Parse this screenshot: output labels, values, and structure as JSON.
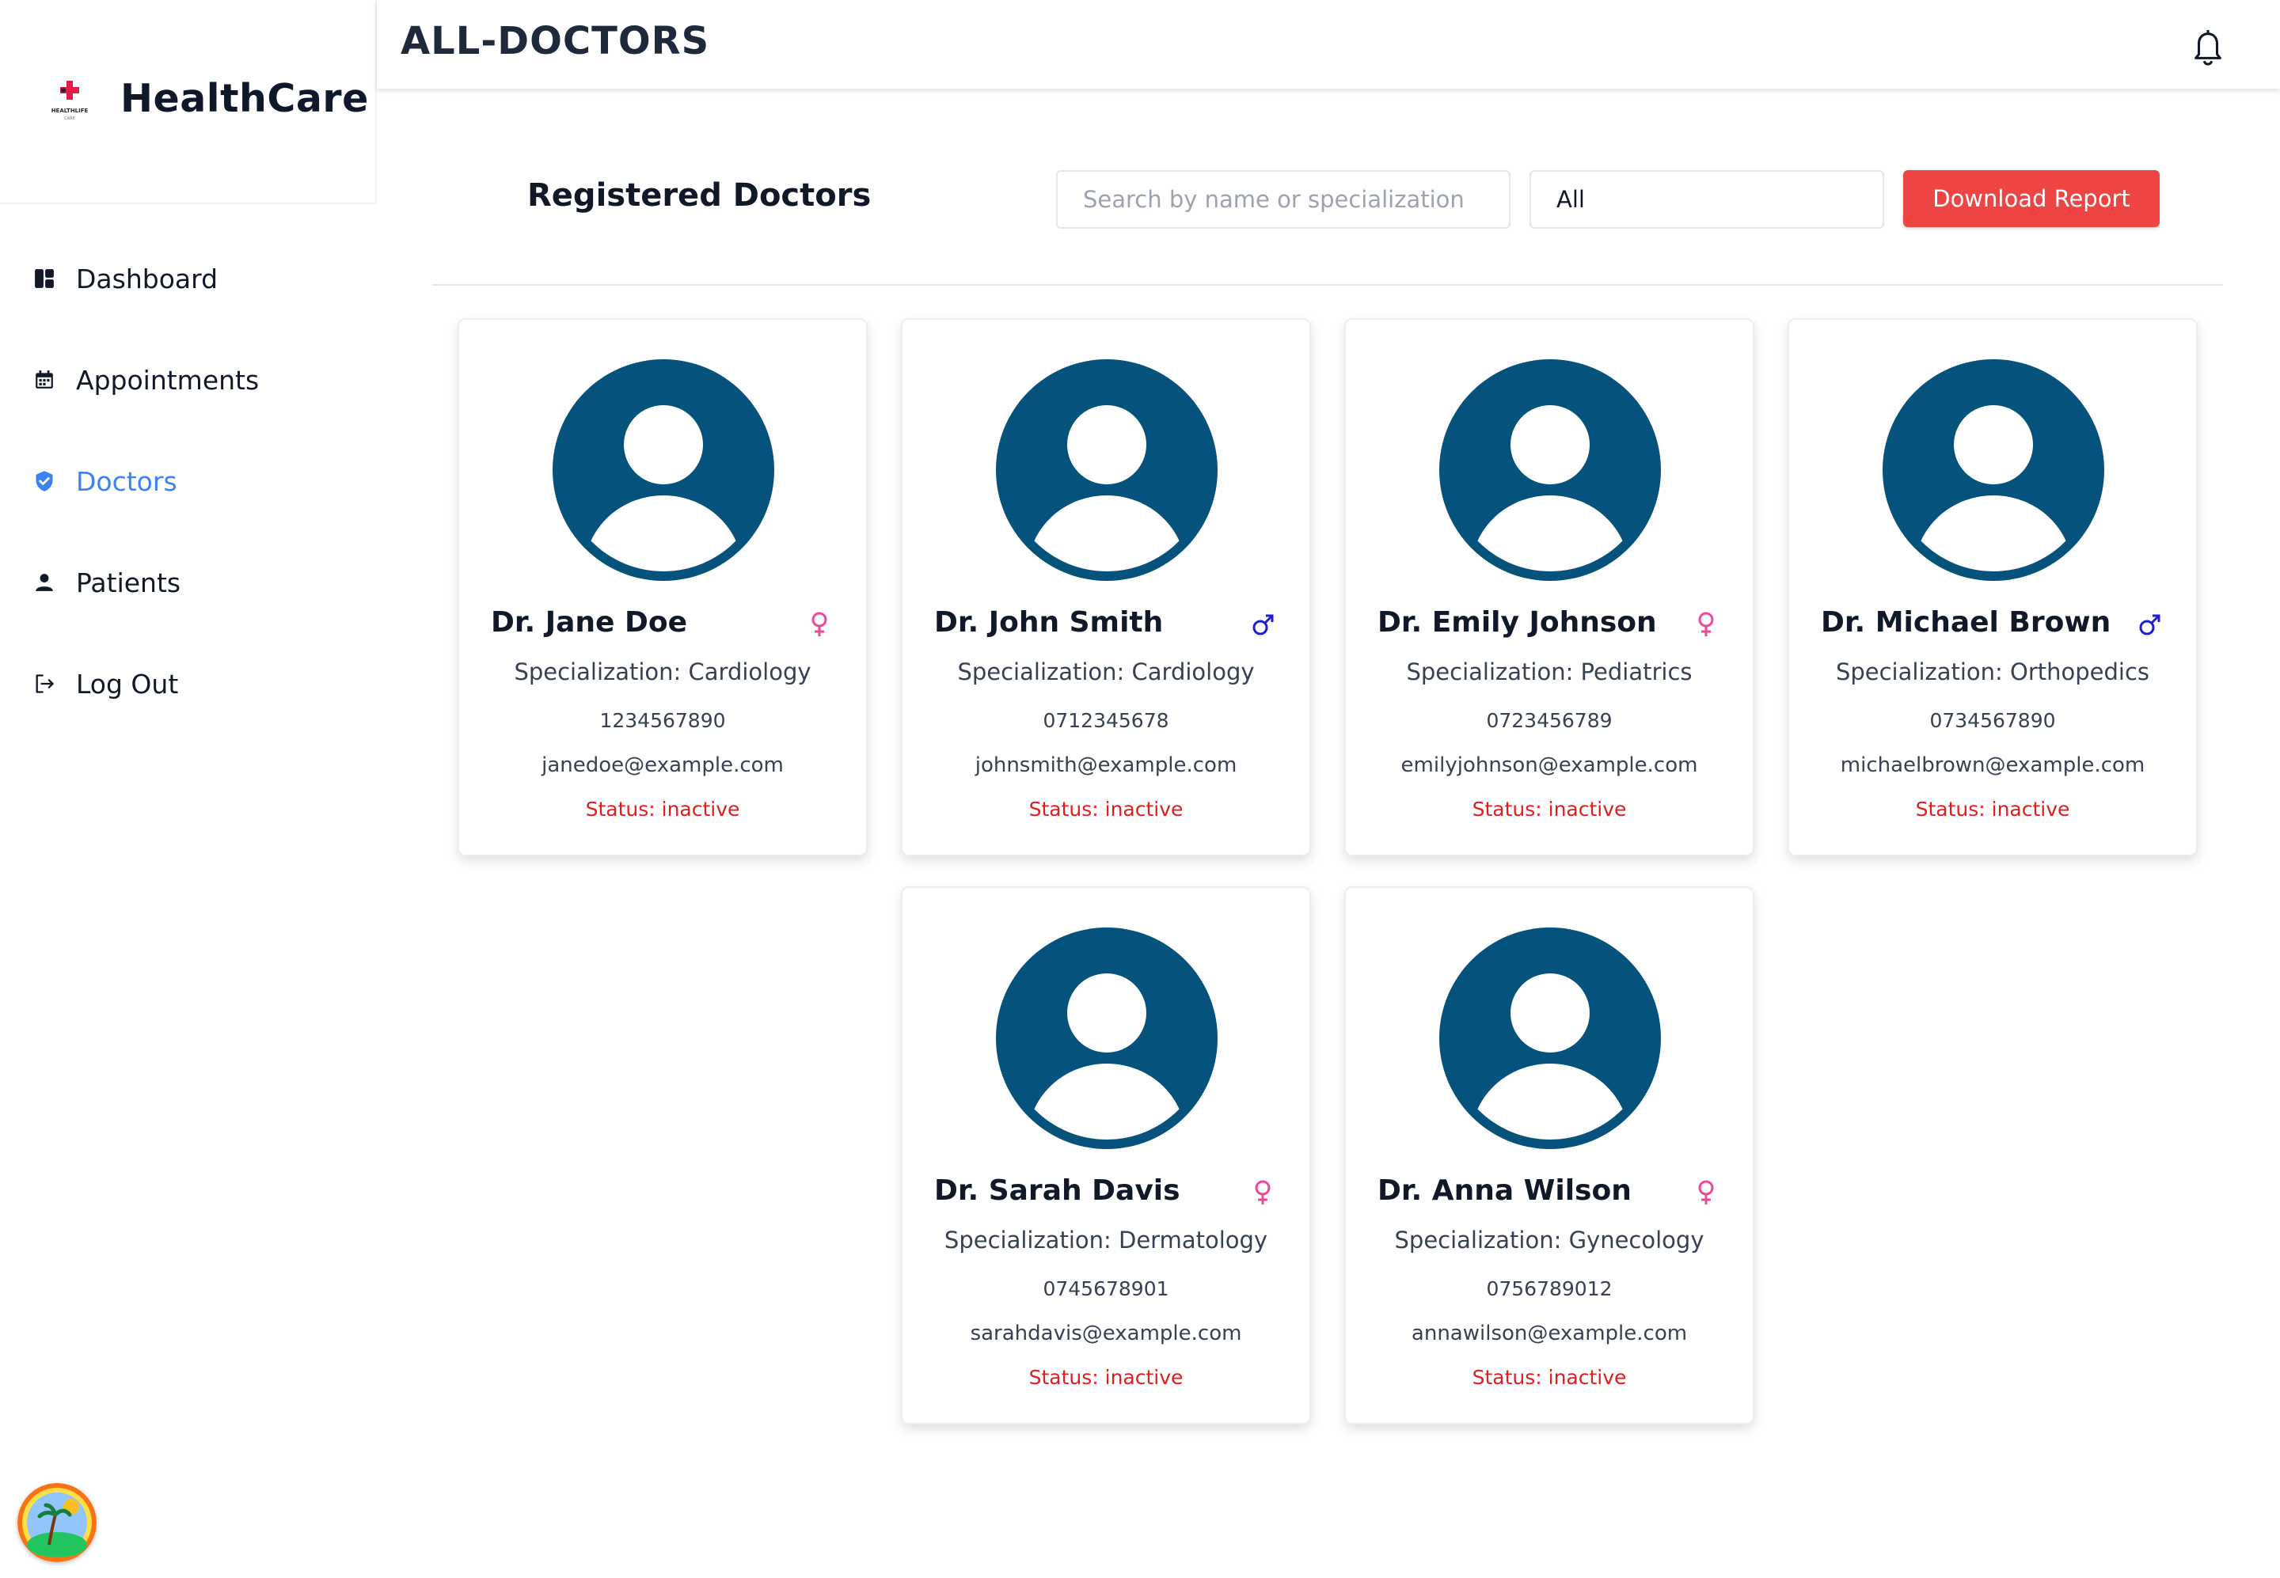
{
  "app": {
    "name": "HealthCare",
    "logo_text": "HEALTHLIFE",
    "logo_subtext": "CARE"
  },
  "header": {
    "title": "ALL-DOCTORS"
  },
  "sidebar": {
    "items": [
      {
        "label": "Dashboard",
        "icon": "dashboard-icon",
        "active": false
      },
      {
        "label": "Appointments",
        "icon": "calendar-icon",
        "active": false
      },
      {
        "label": "Doctors",
        "icon": "shield-check-icon",
        "active": true
      },
      {
        "label": "Patients",
        "icon": "person-icon",
        "active": false
      },
      {
        "label": "Log Out",
        "icon": "logout-icon",
        "active": false
      }
    ]
  },
  "main": {
    "section_title": "Registered Doctors",
    "search": {
      "placeholder": "Search by name or specialization",
      "value": ""
    },
    "filter": {
      "selected": "All"
    },
    "download_label": "Download Report",
    "doctors": [
      {
        "name": "Dr. Jane Doe",
        "gender": "female",
        "specialization": "Specialization: Cardiology",
        "phone": "1234567890",
        "email": "janedoe@example.com",
        "status": "Status: inactive"
      },
      {
        "name": "Dr. John Smith",
        "gender": "male",
        "specialization": "Specialization: Cardiology",
        "phone": "0712345678",
        "email": "johnsmith@example.com",
        "status": "Status: inactive"
      },
      {
        "name": "Dr. Emily Johnson",
        "gender": "female",
        "specialization": "Specialization: Pediatrics",
        "phone": "0723456789",
        "email": "emilyjohnson@example.com",
        "status": "Status: inactive"
      },
      {
        "name": "Dr. Michael Brown",
        "gender": "male",
        "specialization": "Specialization: Orthopedics",
        "phone": "0734567890",
        "email": "michaelbrown@example.com",
        "status": "Status: inactive"
      },
      {
        "name": "Dr. Sarah Davis",
        "gender": "female",
        "specialization": "Specialization: Dermatology",
        "phone": "0745678901",
        "email": "sarahdavis@example.com",
        "status": "Status: inactive"
      },
      {
        "name": "Dr. Anna Wilson",
        "gender": "female",
        "specialization": "Specialization: Gynecology",
        "phone": "0756789012",
        "email": "annawilson@example.com",
        "status": "Status: inactive"
      }
    ]
  },
  "colors": {
    "accent": "#3b82f6",
    "danger": "#ef4444",
    "avatar": "#05527c",
    "status_inactive": "#e11d1d",
    "female": "#ec4899",
    "male": "#1d1dd6"
  }
}
